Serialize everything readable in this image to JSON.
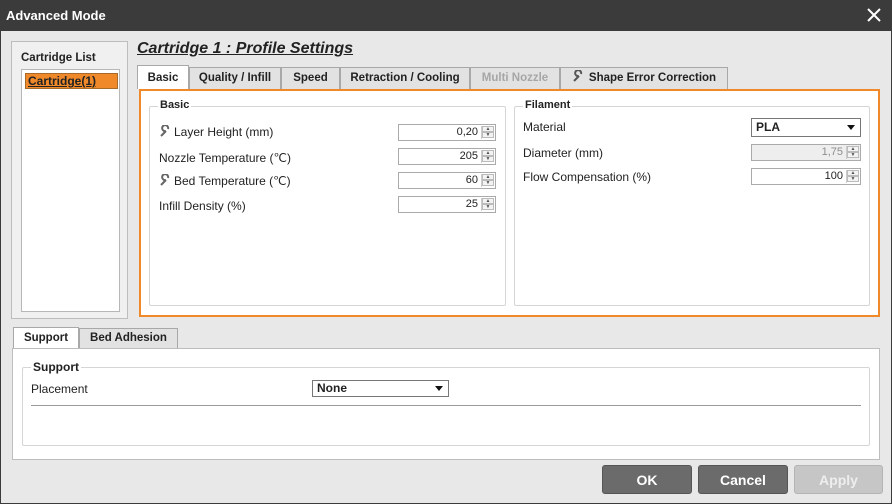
{
  "window": {
    "title": "Advanced Mode",
    "close_icon": "close-icon"
  },
  "cartridge_list": {
    "label": "Cartridge List",
    "items": [
      "Cartridge(1)"
    ]
  },
  "profile": {
    "title": "Cartridge 1 : Profile Settings"
  },
  "tabs": [
    {
      "label": "Basic",
      "state": "active"
    },
    {
      "label": "Quality / Infill",
      "state": "normal"
    },
    {
      "label": "Speed",
      "state": "normal"
    },
    {
      "label": "Retraction / Cooling",
      "state": "normal"
    },
    {
      "label": "Multi Nozzle",
      "state": "disabled"
    },
    {
      "label": "Shape Error Correction",
      "state": "normal",
      "icon": "wrench-icon"
    }
  ],
  "basic_group": {
    "title": "Basic",
    "rows": [
      {
        "label": "Layer Height (mm)",
        "value": "0,20",
        "icon": "wrench-icon"
      },
      {
        "label": "Nozzle Temperature (℃)",
        "value": "205"
      },
      {
        "label": "Bed Temperature (℃)",
        "value": "60",
        "icon": "wrench-icon"
      },
      {
        "label": "Infill Density (%)",
        "value": "25"
      }
    ]
  },
  "filament_group": {
    "title": "Filament",
    "material_label": "Material",
    "material_value": "PLA",
    "diameter_label": "Diameter (mm)",
    "diameter_value": "1,75",
    "flow_label": "Flow Compensation (%)",
    "flow_value": "100"
  },
  "bottom_tabs": [
    {
      "label": "Support",
      "state": "active"
    },
    {
      "label": "Bed Adhesion",
      "state": "normal"
    }
  ],
  "support_group": {
    "title": "Support",
    "placement_label": "Placement",
    "placement_value": "None"
  },
  "buttons": {
    "ok": "OK",
    "cancel": "Cancel",
    "apply": "Apply"
  },
  "colors": {
    "accent": "#f0892a",
    "titlebar": "#3b3b3b"
  }
}
